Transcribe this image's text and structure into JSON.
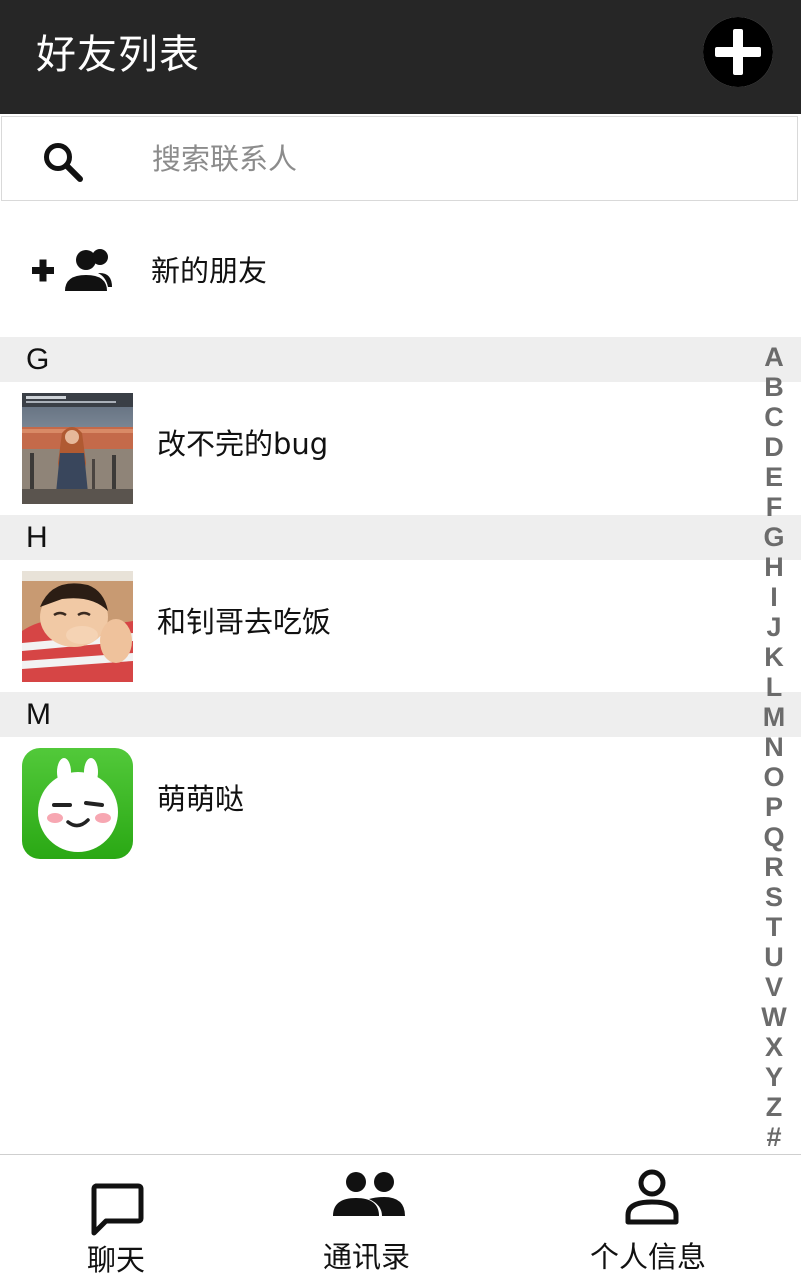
{
  "app_bar": {
    "title": "好友列表",
    "add_icon": "plus-circle-icon"
  },
  "search": {
    "placeholder": "搜索联系人",
    "icon": "search-icon"
  },
  "new_friends": {
    "label": "新的朋友",
    "icon": "add-group-icon"
  },
  "sections": [
    {
      "letter": "G",
      "contacts": [
        {
          "name": "改不完的bug",
          "avatar": "photo-girl-outdoors"
        }
      ]
    },
    {
      "letter": "H",
      "contacts": [
        {
          "name": "和钊哥去吃饭",
          "avatar": "photo-sleeping-child"
        }
      ]
    },
    {
      "letter": "M",
      "contacts": [
        {
          "name": "萌萌哒",
          "avatar": "green-bunny-face"
        }
      ]
    }
  ],
  "index_bar": [
    "A",
    "B",
    "C",
    "D",
    "E",
    "F",
    "G",
    "H",
    "I",
    "J",
    "K",
    "L",
    "M",
    "N",
    "O",
    "P",
    "Q",
    "R",
    "S",
    "T",
    "U",
    "V",
    "W",
    "X",
    "Y",
    "Z",
    "#"
  ],
  "bottom_nav": {
    "items": [
      {
        "label": "聊天",
        "icon": "chat-bubble-icon"
      },
      {
        "label": "通讯录",
        "icon": "contacts-group-icon"
      },
      {
        "label": "个人信息",
        "icon": "person-icon"
      }
    ]
  },
  "colors": {
    "app_bar_bg": "#262626",
    "section_bg": "#eeeeee",
    "index_text": "#6b6b6b",
    "bunny_green": "#3cb81f"
  }
}
